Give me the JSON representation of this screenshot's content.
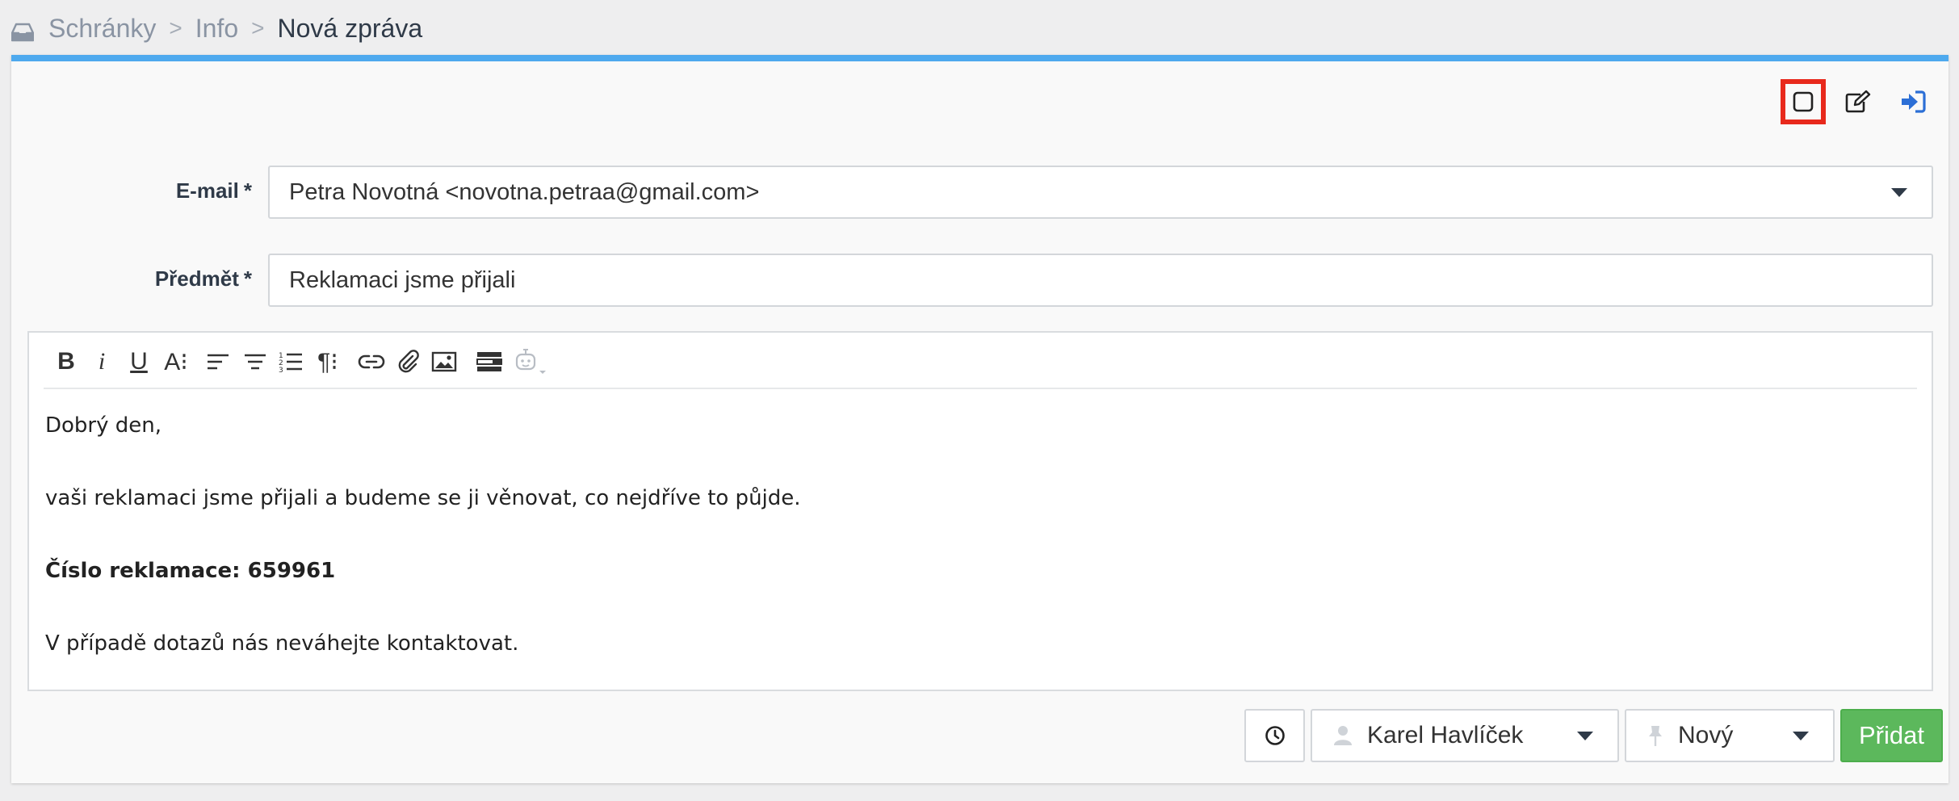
{
  "breadcrumb": {
    "icon": "inbox-icon",
    "items": [
      "Schránky",
      "Info",
      "Nová zpráva"
    ],
    "separator": ">"
  },
  "colors": {
    "accent_border": "#4ea9ee",
    "highlight": "#e8291c",
    "submit": "#5cb85c",
    "link_icon": "#2c6fd6"
  },
  "top_actions": [
    {
      "icon": "square-icon",
      "highlighted": true
    },
    {
      "icon": "edit-icon"
    },
    {
      "icon": "sign-in-icon"
    }
  ],
  "form": {
    "email": {
      "label": "E-mail",
      "required_mark": "*",
      "value": "Petra Novotná <novotna.petraa@gmail.com>"
    },
    "subject": {
      "label": "Předmět",
      "required_mark": "*",
      "value": "Reklamaci jsme přijali"
    }
  },
  "editor": {
    "toolbar": [
      "bold-icon",
      "italic-icon",
      "underline-icon",
      "font-size-icon",
      "align-left-icon",
      "align-center-icon",
      "ordered-list-icon",
      "paragraph-icon",
      "link-icon",
      "attachment-icon",
      "image-icon",
      "template-icon",
      "bot-icon"
    ],
    "toolbar_labels": {
      "bold": "B",
      "italic": "i",
      "underline": "U",
      "font_size": "A⁝",
      "paragraph": "¶⁝"
    },
    "body": [
      {
        "text": "Dobrý den,",
        "bold": false
      },
      {
        "text": "vaši reklamaci jsme přijali a budeme se ji věnovat, co nejdříve to půjde.",
        "bold": false
      },
      {
        "text": "Číslo reklamace: 659961",
        "bold": true
      },
      {
        "text": "V případě dotazů nás neváhejte kontaktovat.",
        "bold": false
      }
    ]
  },
  "footer": {
    "schedule_icon": "clock-icon",
    "assignee": "Karel Havlíček",
    "status": "Nový",
    "submit_label": "Přidat"
  }
}
